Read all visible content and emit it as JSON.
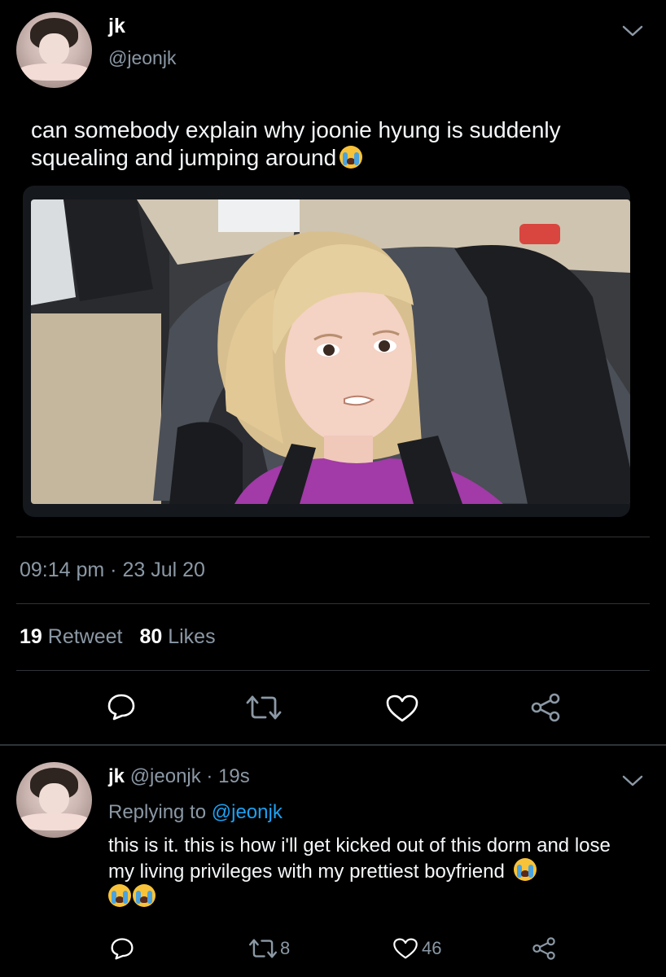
{
  "main_tweet": {
    "name": "jk",
    "handle": "@jeonjk",
    "text": "can somebody explain why joonie hyung is suddenly squealing and jumping around",
    "emoji": "loudly-crying-face",
    "timestamp": "09:14 pm · 23 Jul 20",
    "retweet_count": "19",
    "retweet_label": "Retweet",
    "likes_count": "80",
    "likes_label": "Likes",
    "media_description_icon": "photo"
  },
  "reply_tweet": {
    "name": "jk",
    "handle_time": "@jeonjk · 19s",
    "replying_prefix": "Replying to",
    "replying_to": "@jeonjk",
    "text": "this is it. this is how i'll get kicked out of this dorm and lose my living privileges with my prettiest boyfriend",
    "emoji_count": 3,
    "retweets": "8",
    "likes": "46"
  },
  "colors": {
    "background": "#000000",
    "muted": "#8b98a5",
    "link": "#1da1f2",
    "divider": "#2f3336"
  },
  "icons": [
    "reply-icon",
    "retweet-icon",
    "like-icon",
    "share-icon",
    "chevron-down-icon"
  ]
}
